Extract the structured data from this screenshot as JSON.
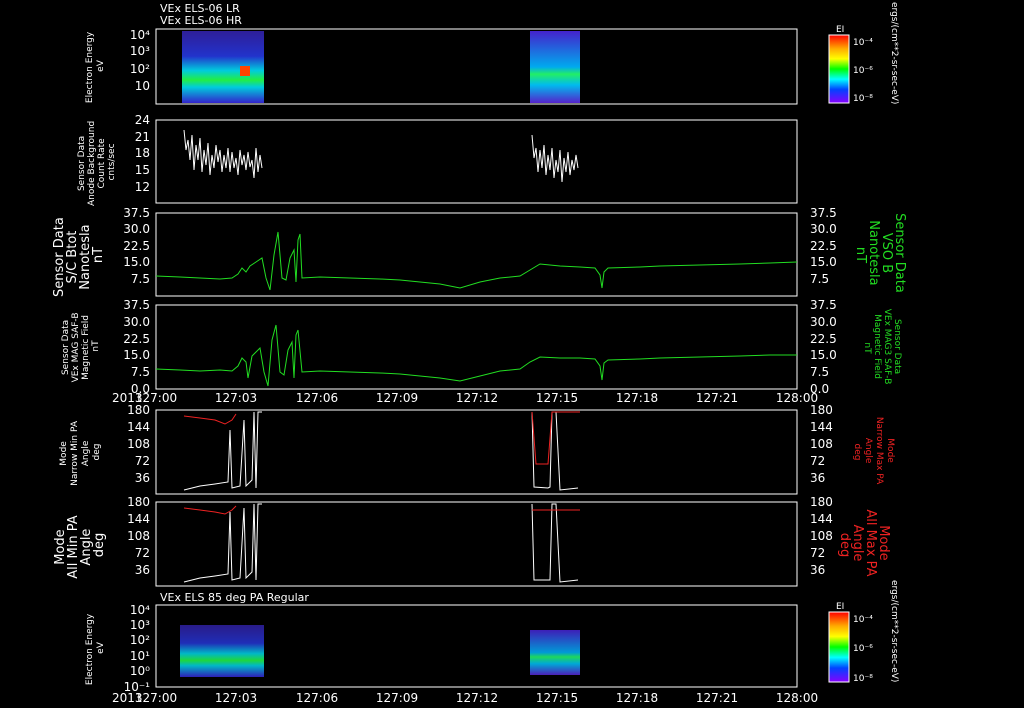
{
  "colors": {
    "background": "#000000",
    "axes": "#ffffff",
    "green": "#22dd22",
    "red": "#ee2222",
    "white": "#ffffff"
  },
  "header": {
    "line1": "VEx ELS-06 LR",
    "line2": "VEx ELS-06 HR"
  },
  "panels": {
    "p1": {
      "ylabel": [
        "Electron Energy",
        "eV"
      ],
      "cbar_title": "EI",
      "cbar_ticks": [
        "10⁻⁴",
        "10⁻⁶",
        "10⁻⁸"
      ],
      "cbar_units": "ergs/(cm**2-sr-sec-eV)"
    },
    "p2": {
      "ylabel": [
        "Sensor Data",
        "Anode Background",
        "Count Rate",
        "cnts/sec"
      ],
      "yticks": [
        "24",
        "21",
        "18",
        "15",
        "12"
      ]
    },
    "p3": {
      "ylabel": [
        "Sensor Data",
        "S/C Btot",
        "Nanotesla",
        "nT"
      ],
      "yticks": [
        "37.5",
        "30.0",
        "22.5",
        "15.0",
        "7.5"
      ],
      "rlabel": [
        "Sensor Data",
        "VSO B",
        "Nanotesla",
        "nT"
      ]
    },
    "p4": {
      "ylabel": [
        "Sensor Data",
        "VEx MAG SAF-B",
        "Magnetic Field",
        "nT"
      ],
      "yticks": [
        "37.5",
        "30.0",
        "22.5",
        "15.0",
        "7.5",
        "0.0"
      ],
      "rlabel": [
        "Sensor Data",
        "VEx MAG3 SAF-B",
        "Magnetic Field",
        "nT"
      ]
    },
    "p5": {
      "ylabel": [
        "Mode",
        "Narrow Min PA",
        "Angle",
        "deg"
      ],
      "yticks": [
        "180",
        "144",
        "108",
        "72",
        "36"
      ],
      "rlabel": [
        "Mode",
        "Narrow Max PA",
        "Angle",
        "deg"
      ]
    },
    "p6": {
      "ylabel": [
        "Mode",
        "All Min PA",
        "Angle",
        "deg"
      ],
      "yticks": [
        "180",
        "144",
        "108",
        "72",
        "36"
      ],
      "rlabel": [
        "Mode",
        "All Max PA",
        "Angle",
        "deg"
      ]
    },
    "p7": {
      "title": "VEx ELS 85 deg PA Regular",
      "ylabel": [
        "Electron Energy",
        "eV"
      ],
      "cbar_title": "EI",
      "cbar_ticks": [
        "10⁻⁴",
        "10⁻⁶",
        "10⁻⁸"
      ],
      "cbar_units": "ergs/(cm**2-sr-sec-eV)"
    }
  },
  "energy_ticks_top": [
    "10⁴",
    "10³",
    "10²",
    "10"
  ],
  "energy_ticks_bottom": [
    "10⁴",
    "10³",
    "10²",
    "10¹",
    "10⁰",
    "10⁻¹"
  ],
  "time_axis": {
    "year": "2013",
    "labels": [
      "127:00",
      "127:03",
      "127:06",
      "127:09",
      "127:12",
      "127:15",
      "127:18",
      "127:21",
      "128:00"
    ]
  },
  "chart_data": [
    {
      "type": "heatmap",
      "title": "VEx ELS-06 LR / VEx ELS-06 HR",
      "ylabel": "Electron Energy eV",
      "x_range": [
        "127:00",
        "128:00"
      ],
      "y_scale": "log",
      "coverage_intervals": [
        [
          "127:01",
          "127:03"
        ],
        [
          "127:13",
          "127:15"
        ]
      ]
    },
    {
      "type": "line",
      "ylabel": "Anode Background Count Rate cnts/sec",
      "ylim": [
        12,
        24
      ],
      "series": [
        {
          "x": [
            "127:01",
            "127:01",
            "127:01",
            "127:02",
            "127:02",
            "127:02",
            "127:03",
            "127:03",
            "127:03"
          ],
          "values": [
            20,
            22,
            16,
            19,
            15,
            18,
            14,
            17,
            16
          ]
        },
        {
          "x": [
            "127:13",
            "127:14",
            "127:14",
            "127:14",
            "127:15",
            "127:15",
            "127:15"
          ],
          "values": [
            17,
            15,
            18,
            13,
            16,
            14,
            16
          ]
        }
      ]
    },
    {
      "type": "line",
      "ylabel": "S/C Btot nT",
      "ylim": [
        0,
        37.5
      ],
      "series": [
        {
          "x": [
            "127:00",
            "127:01",
            "127:02",
            "127:03",
            "127:03",
            "127:04",
            "127:04",
            "127:04",
            "127:04",
            "127:05",
            "127:06",
            "127:07",
            "127:08",
            "127:09",
            "127:10",
            "127:11",
            "127:12",
            "127:13",
            "127:14",
            "127:15",
            "127:16",
            "127:16",
            "127:16",
            "127:17",
            "127:18",
            "127:19",
            "127:20",
            "127:21",
            "127:22",
            "127:23",
            "128:00"
          ],
          "values": [
            8.5,
            8.2,
            8.0,
            9.5,
            12,
            5,
            28,
            8,
            26,
            8,
            8.5,
            8.5,
            8,
            7.5,
            6.5,
            8,
            9,
            12,
            14.5,
            14,
            13,
            4,
            12,
            13,
            13.5,
            13.5,
            14,
            14,
            14.5,
            14.5,
            14.5
          ]
        }
      ]
    },
    {
      "type": "line",
      "ylabel": "VEx MAG SAF-B nT",
      "ylim": [
        0,
        37.5
      ],
      "series": [
        {
          "x": [
            "127:00",
            "127:01",
            "127:02",
            "127:03",
            "127:03",
            "127:04",
            "127:04",
            "127:04",
            "127:04",
            "127:05",
            "127:06",
            "127:07",
            "127:08",
            "127:09",
            "127:10",
            "127:11",
            "127:12",
            "127:13",
            "127:14",
            "127:15",
            "127:16",
            "127:16",
            "127:16",
            "127:17",
            "127:18",
            "127:19",
            "127:20",
            "127:21",
            "127:22",
            "127:23",
            "128:00"
          ],
          "values": [
            8.5,
            8.5,
            8,
            10,
            12,
            3,
            29,
            5,
            27,
            8,
            8.5,
            8.5,
            8,
            7.5,
            6,
            8,
            9,
            12,
            14.5,
            14,
            13,
            3,
            12,
            13,
            13.5,
            14,
            14,
            14.5,
            14.5,
            15,
            15
          ]
        }
      ]
    },
    {
      "type": "line",
      "ylabel": "Narrow Min/Max PA deg",
      "ylim": [
        0,
        180
      ],
      "series": [
        {
          "x": [
            "127:00",
            "127:01",
            "127:02",
            "127:03",
            "127:03",
            "127:03",
            "127:03"
          ],
          "values": [
            10,
            15,
            20,
            25,
            180,
            10,
            180
          ]
        },
        {
          "x": [
            "127:00",
            "127:01",
            "127:02",
            "127:03",
            "127:03"
          ],
          "values": [
            165,
            160,
            155,
            150,
            180
          ]
        },
        {
          "x": [
            "127:14",
            "127:14",
            "127:14",
            "127:15",
            "127:15",
            "127:15"
          ],
          "values": [
            180,
            10,
            10,
            10,
            180,
            180
          ]
        },
        {
          "x": [
            "127:14",
            "127:14",
            "127:15",
            "127:15"
          ],
          "values": [
            180,
            65,
            65,
            180
          ]
        }
      ]
    },
    {
      "type": "line",
      "ylabel": "All Min/Max PA deg",
      "ylim": [
        0,
        180
      ],
      "series": [
        {
          "x": [
            "127:00",
            "127:01",
            "127:02",
            "127:03",
            "127:03",
            "127:03",
            "127:03"
          ],
          "values": [
            10,
            15,
            20,
            25,
            180,
            10,
            180
          ]
        },
        {
          "x": [
            "127:00",
            "127:01",
            "127:02",
            "127:03"
          ],
          "values": [
            165,
            162,
            158,
            155
          ]
        },
        {
          "x": [
            "127:14",
            "127:14",
            "127:14",
            "127:15",
            "127:15",
            "127:15"
          ],
          "values": [
            180,
            10,
            10,
            10,
            180,
            180
          ]
        },
        {
          "x": [
            "127:14",
            "127:15"
          ],
          "values": [
            165,
            165
          ]
        }
      ]
    },
    {
      "type": "heatmap",
      "title": "VEx ELS 85 deg PA Regular",
      "ylabel": "Electron Energy eV",
      "x_range": [
        "127:00",
        "128:00"
      ],
      "y_scale": "log",
      "coverage_intervals": [
        [
          "127:01",
          "127:03"
        ],
        [
          "127:13",
          "127:15"
        ]
      ]
    }
  ]
}
